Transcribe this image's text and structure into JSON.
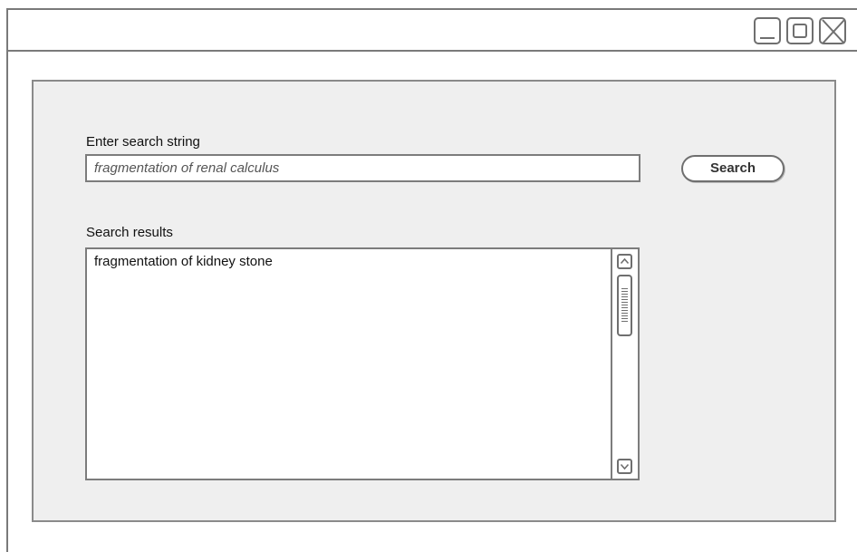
{
  "window": {
    "controls": {
      "minimize_icon": "minimize-icon",
      "maximize_icon": "maximize-icon",
      "close_icon": "close-icon"
    }
  },
  "search": {
    "label": "Enter search string",
    "value": "fragmentation of renal calculus",
    "button_label": "Search"
  },
  "results": {
    "label": "Search results",
    "items": [
      "fragmentation of kidney stone"
    ],
    "scroll_up_icon": "chevron-up-icon",
    "scroll_down_icon": "chevron-down-icon"
  }
}
